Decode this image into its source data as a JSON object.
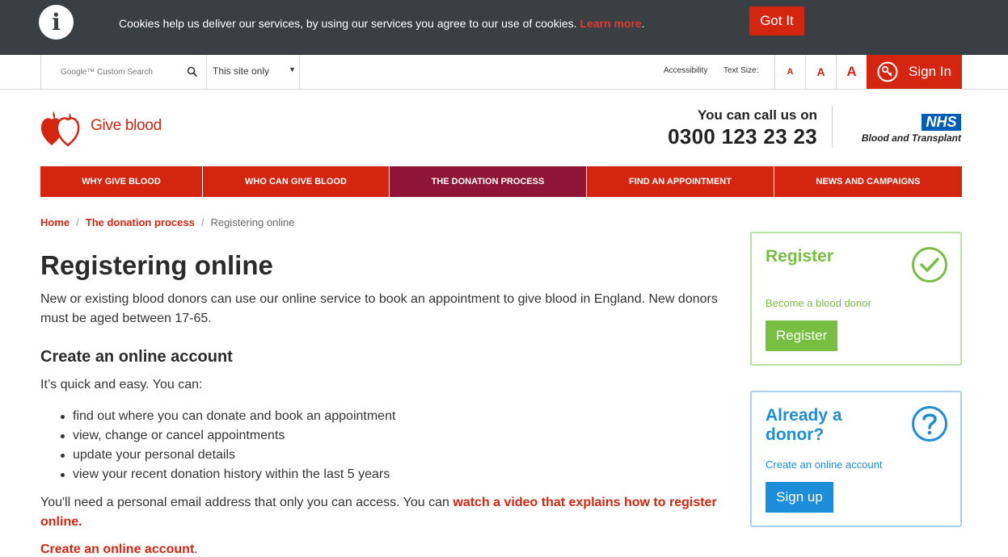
{
  "cookie_bar": {
    "info_icon": "info-icon",
    "message": "Cookies help us deliver our services, by using our services you agree to our use of cookies.",
    "learn_more": "Learn more",
    "period": ".",
    "got_it": "Got It"
  },
  "utility": {
    "search_placeholder": "Google™ Custom Search",
    "scope_value": "This site only",
    "accessibility": "Accessibility",
    "text_size_label": "Text Size:",
    "text_size_small": "A",
    "text_size_medium": "A",
    "text_size_large": "A",
    "sign_in": "Sign In"
  },
  "header": {
    "logo_text": "Give blood",
    "call_title": "You can call us on",
    "phone": "0300 123 23 23",
    "nhs": "NHS",
    "nhs_sub": "Blood and Transplant"
  },
  "nav": {
    "items": [
      {
        "label": "WHY GIVE BLOOD"
      },
      {
        "label": "WHO CAN GIVE BLOOD"
      },
      {
        "label": "THE DONATION PROCESS"
      },
      {
        "label": "FIND AN APPOINTMENT"
      },
      {
        "label": "NEWS AND CAMPAIGNS"
      }
    ]
  },
  "breadcrumb": {
    "home": "Home",
    "section": "The donation process",
    "sep": "/",
    "current": "Registering online"
  },
  "content": {
    "title": "Registering online",
    "intro": "New or existing blood donors can use our online service to book an appointment to give blood in England. New donors must be aged between 17-65.",
    "subtitle": "Create an online account",
    "lead": "It’s quick and easy. You can:",
    "bullets": [
      "find out where you can donate and book an appointment",
      "view, change or cancel appointments",
      "update your personal details",
      "view your recent donation history within the last 5 years"
    ],
    "email_text": "You'll need a personal email address that only you can access. You can",
    "video_link": "watch a video that explains how to register online.",
    "create_link": "Create an online account",
    "create_period": "."
  },
  "sidebar": {
    "register": {
      "title": "Register",
      "text": "Become a blood donor",
      "button": "Register",
      "icon": "check-circle-icon"
    },
    "donor": {
      "title_line1": "Already a",
      "title_line2": "donor?",
      "text": "Create an online account",
      "button": "Sign up",
      "icon": "question-circle-icon"
    }
  },
  "colors": {
    "brand_red": "#d3250f",
    "nav_active": "#8e1538",
    "green": "#78be43",
    "blue": "#1c8dd8",
    "nhs_blue": "#005eb8",
    "cookie_bg": "#3a3f44"
  }
}
